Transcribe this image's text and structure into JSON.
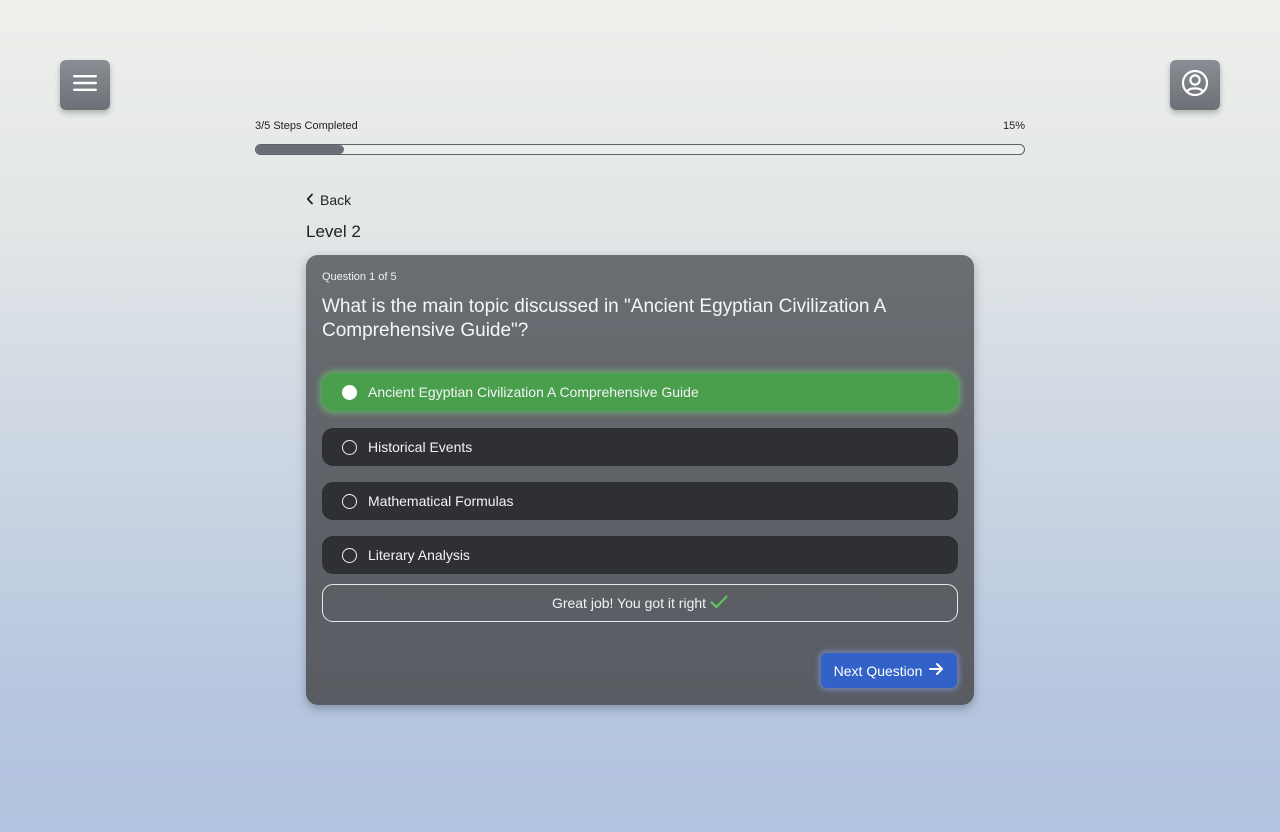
{
  "header": {
    "menu_icon": "hamburger-menu-icon",
    "profile_icon": "user-circle-icon"
  },
  "progress": {
    "steps_label": "3/5 Steps Completed",
    "percent_label": "15%",
    "fraction": 0.115
  },
  "nav": {
    "back_label": "Back",
    "level_title": "Level 2"
  },
  "quiz": {
    "question_counter": "Question 1 of 5",
    "question_text": "What is the main topic discussed in \"Ancient Egyptian Civilization A Comprehensive Guide\"?",
    "options": [
      {
        "label": "Ancient Egyptian Civilization A Comprehensive Guide",
        "state": "correct-selected"
      },
      {
        "label": "Historical Events",
        "state": "unselected"
      },
      {
        "label": "Mathematical Formulas",
        "state": "unselected"
      },
      {
        "label": "Literary Analysis",
        "state": "unselected"
      }
    ],
    "feedback_text": "Great job! You got it right",
    "next_label": "Next Question"
  },
  "colors": {
    "correct_green": "#4a9f4d",
    "check_green": "#5fc45f",
    "primary_blue": "#3261c7",
    "option_dark": "#2f3034",
    "card_gray": "#64676d"
  }
}
